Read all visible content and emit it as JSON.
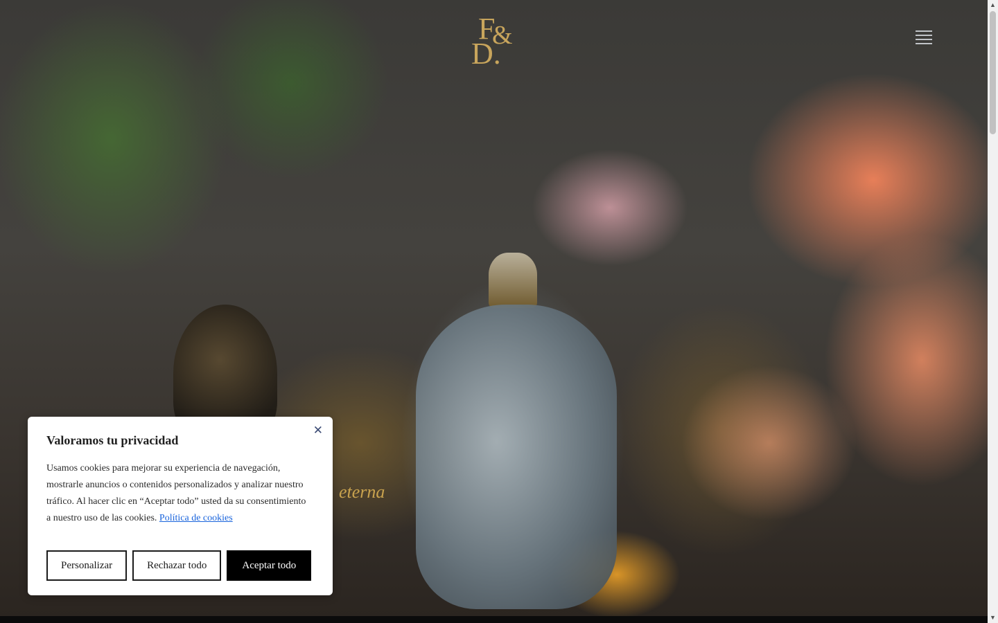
{
  "brand": {
    "logo_top": "F",
    "logo_amp": "&",
    "logo_bottom": "D."
  },
  "hero": {
    "partial_word": "eterna"
  },
  "cookie_banner": {
    "title": "Valoramos tu privacidad",
    "body": "Usamos cookies para mejorar su experiencia de navegación, mostrarle anuncios o contenidos personalizados y analizar nuestro tráfico. Al hacer clic en “Aceptar todo” usted da su consentimiento a nuestro uso de las cookies.",
    "policy_link": "Política de cookies",
    "buttons": {
      "customize": "Personalizar",
      "reject": "Rechazar todo",
      "accept": "Aceptar todo"
    },
    "close_icon": "close-icon"
  },
  "colors": {
    "accent_gold": "#c8a55c",
    "link": "#1863dc",
    "button_dark": "#000000"
  }
}
